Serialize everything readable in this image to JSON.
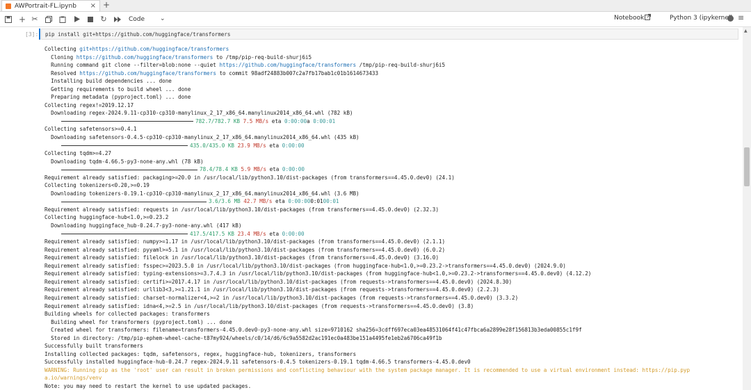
{
  "tabs": [
    {
      "label": "AWPortrait-FL.ipynb"
    }
  ],
  "toolbar": {
    "cell_type": "Code",
    "notebook_label": "Notebook",
    "kernel_label": "Python 3 (ipykernel)"
  },
  "cell": {
    "prompt": "[3]:",
    "code": "pip install git+https://github.com/huggingface/transformers"
  },
  "output": {
    "l1a": "Collecting ",
    "l1b": "git+https://github.com/huggingface/transformers",
    "l2a": "  Cloning ",
    "l2b": "https://github.com/huggingface/transformers",
    "l2c": " to /tmp/pip-req-build-shurj6i5",
    "l3a": "  Running command git clone --filter=blob:none --quiet ",
    "l3b": "https://github.com/huggingface/transformers",
    "l3c": " /tmp/pip-req-build-shurj6i5",
    "l4a": "  Resolved ",
    "l4b": "https://github.com/huggingface/transformers",
    "l4c": " to commit 98adf24883b007c2a7fb17bab1c01b1614673433",
    "l5": "  Installing build dependencies ... done",
    "l6": "  Getting requirements to build wheel ... done",
    "l7": "  Preparing metadata (pyproject.toml) ... done",
    "l8": "Collecting regex!=2019.12.17",
    "l9": "  Downloading regex-2024.9.11-cp310-cp310-manylinux_2_17_x86_64.manylinux2014_x86_64.whl (782 kB)",
    "l10a": "782.7/782.7 KB",
    "l10b": "7.5 MB/s",
    "l10c": " eta ",
    "l10d": "0:00:00",
    "l10e": "a ",
    "l10f": "0:00:01",
    "l11": "Collecting safetensors>=0.4.1",
    "l12": "  Downloading safetensors-0.4.5-cp310-cp310-manylinux_2_17_x86_64.manylinux2014_x86_64.whl (435 kB)",
    "l13a": "435.0/435.0 KB",
    "l13b": "23.9 MB/s",
    "l13c": " eta ",
    "l13d": "0:00:00",
    "l14": "Collecting tqdm>=4.27",
    "l15": "  Downloading tqdm-4.66.5-py3-none-any.whl (78 kB)",
    "l16a": "78.4/78.4 KB",
    "l16b": "5.9 MB/s",
    "l16c": " eta ",
    "l16d": "0:00:00",
    "l17": "Requirement already satisfied: packaging>=20.0 in /usr/local/lib/python3.10/dist-packages (from transformers==4.45.0.dev0) (24.1)",
    "l18": "Collecting tokenizers<0.20,>=0.19",
    "l19": "  Downloading tokenizers-0.19.1-cp310-cp310-manylinux_2_17_x86_64.manylinux2014_x86_64.whl (3.6 MB)",
    "l20a": "3.6/3.6 MB",
    "l20b": "42.7 MB/s",
    "l20c": " eta ",
    "l20d": "0:00:00",
    "l20e": "0:01",
    "l20f": "00:01",
    "l21": "Requirement already satisfied: requests in /usr/local/lib/python3.10/dist-packages (from transformers==4.45.0.dev0) (2.32.3)",
    "l22": "Collecting huggingface-hub<1.0,>=0.23.2",
    "l23": "  Downloading huggingface_hub-0.24.7-py3-none-any.whl (417 kB)",
    "l24a": "417.5/417.5 KB",
    "l24b": "23.4 MB/s",
    "l24c": " eta ",
    "l24d": "0:00:00",
    "l25": "Requirement already satisfied: numpy>=1.17 in /usr/local/lib/python3.10/dist-packages (from transformers==4.45.0.dev0) (2.1.1)",
    "l26": "Requirement already satisfied: pyyaml>=5.1 in /usr/local/lib/python3.10/dist-packages (from transformers==4.45.0.dev0) (6.0.2)",
    "l27": "Requirement already satisfied: filelock in /usr/local/lib/python3.10/dist-packages (from transformers==4.45.0.dev0) (3.16.0)",
    "l28": "Requirement already satisfied: fsspec>=2023.5.0 in /usr/local/lib/python3.10/dist-packages (from huggingface-hub<1.0,>=0.23.2->transformers==4.45.0.dev0) (2024.9.0)",
    "l29": "Requirement already satisfied: typing-extensions>=3.7.4.3 in /usr/local/lib/python3.10/dist-packages (from huggingface-hub<1.0,>=0.23.2->transformers==4.45.0.dev0) (4.12.2)",
    "l30": "Requirement already satisfied: certifi>=2017.4.17 in /usr/local/lib/python3.10/dist-packages (from requests->transformers==4.45.0.dev0) (2024.8.30)",
    "l31": "Requirement already satisfied: urllib3<3,>=1.21.1 in /usr/local/lib/python3.10/dist-packages (from requests->transformers==4.45.0.dev0) (2.2.3)",
    "l32": "Requirement already satisfied: charset-normalizer<4,>=2 in /usr/local/lib/python3.10/dist-packages (from requests->transformers==4.45.0.dev0) (3.3.2)",
    "l33": "Requirement already satisfied: idna<4,>=2.5 in /usr/local/lib/python3.10/dist-packages (from requests->transformers==4.45.0.dev0) (3.8)",
    "l34": "Building wheels for collected packages: transformers",
    "l35": "  Building wheel for transformers (pyproject.toml) ... done",
    "l36": "  Created wheel for transformers: filename=transformers-4.45.0.dev0-py3-none-any.whl size=9710162 sha256=3cdff697eca03ea48531064f41c47fbca6a2899e28f156813b3eda00855c1f9f",
    "l37": "  Stored in directory: /tmp/pip-ephem-wheel-cache-t87my924/wheels/c0/14/d6/6c9a5582d2ac191ec0a483be151a4495fe1eb2a6706ca49f1b",
    "l38": "Successfully built transformers",
    "l39": "Installing collected packages: tqdm, safetensors, regex, huggingface-hub, tokenizers, transformers",
    "l40": "Successfully installed huggingface-hub-0.24.7 regex-2024.9.11 safetensors-0.4.5 tokenizers-0.19.1 tqdm-4.66.5 transformers-4.45.0.dev0",
    "l41": "WARNING: Running pip as the 'root' user can result in broken permissions and conflicting behaviour with the system package manager. It is recommended to use a virtual environment instead: https://pip.pyp",
    "l42": "a.io/warnings/venv",
    "l43": "Note: you may need to restart the kernel to use updated packages."
  }
}
